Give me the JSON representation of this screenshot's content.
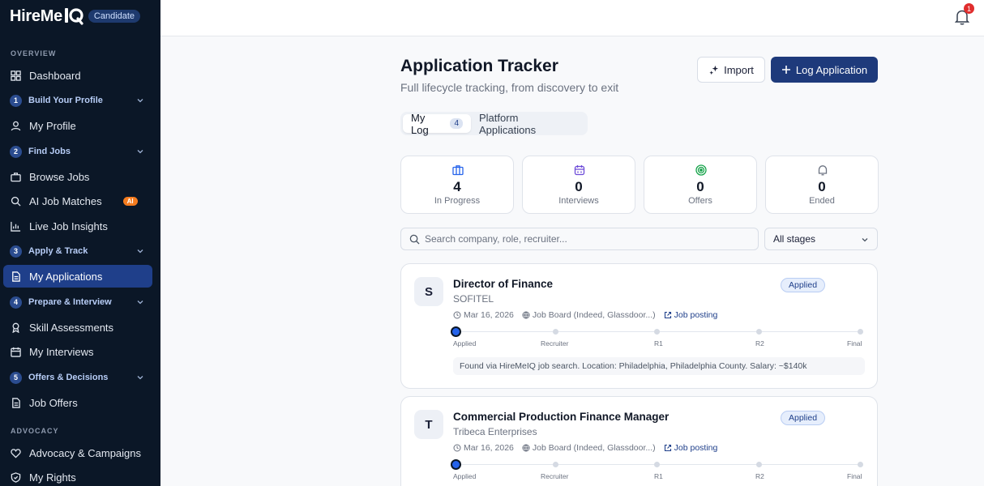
{
  "brand": {
    "name": "HireMe",
    "mark": "IQ",
    "role_badge": "Candidate"
  },
  "sidebar": {
    "sections": [
      {
        "label": "OVERVIEW"
      },
      {
        "label": "ADVOCACY"
      }
    ],
    "items": [
      {
        "label": "Dashboard",
        "icon": "grid-icon"
      },
      {
        "label": "Build Your Profile",
        "step": "1",
        "group": true
      },
      {
        "label": "My Profile",
        "icon": "user-icon"
      },
      {
        "label": "Find Jobs",
        "step": "2",
        "group": true
      },
      {
        "label": "Browse Jobs",
        "icon": "briefcase-icon"
      },
      {
        "label": "AI Job Matches",
        "icon": "search-icon",
        "badge": "AI"
      },
      {
        "label": "Live Job Insights",
        "icon": "chart-icon"
      },
      {
        "label": "Apply & Track",
        "step": "3",
        "group": true
      },
      {
        "label": "My Applications",
        "icon": "document-icon",
        "active": true
      },
      {
        "label": "Prepare & Interview",
        "step": "4",
        "group": true
      },
      {
        "label": "Skill Assessments",
        "icon": "award-icon"
      },
      {
        "label": "My Interviews",
        "icon": "calendar-icon"
      },
      {
        "label": "Offers & Decisions",
        "step": "5",
        "group": true
      },
      {
        "label": "Job Offers",
        "icon": "document-icon"
      },
      {
        "label": "Advocacy & Campaigns",
        "icon": "heart-icon"
      },
      {
        "label": "My Rights",
        "icon": "shield-icon"
      }
    ]
  },
  "topbar": {
    "notification_count": "1"
  },
  "header": {
    "title": "Application Tracker",
    "subtitle": "Full lifecycle tracking, from discovery to exit",
    "import_label": "Import",
    "log_label": "Log Application"
  },
  "tabs": [
    {
      "label": "My Log",
      "count": "4",
      "active": true
    },
    {
      "label": "Platform Applications"
    }
  ],
  "stats": [
    {
      "value": "4",
      "label": "In Progress",
      "icon": "briefcase-icon",
      "color": "#2563eb"
    },
    {
      "value": "0",
      "label": "Interviews",
      "icon": "calendar-icon",
      "color": "#6d4bd8"
    },
    {
      "value": "0",
      "label": "Offers",
      "icon": "target-icon",
      "color": "#16a34a"
    },
    {
      "value": "0",
      "label": "Ended",
      "icon": "bell-icon",
      "color": "#6b7280"
    }
  ],
  "filters": {
    "search_placeholder": "Search company, role, recruiter...",
    "stage_value": "All stages"
  },
  "stages": [
    "Applied",
    "Recruiter",
    "R1",
    "R2",
    "Final"
  ],
  "applications": [
    {
      "initial": "S",
      "role": "Director of Finance",
      "company": "SOFITEL",
      "status": "Applied",
      "date": "Mar 16, 2026",
      "source": "Job Board (Indeed, Glassdoor...)",
      "link": "Job posting",
      "note": "Found via HireMeIQ job search. Location: Philadelphia, Philadelphia County. Salary: ~$140k"
    },
    {
      "initial": "T",
      "role": "Commercial Production Finance Manager",
      "company": "Tribeca Enterprises",
      "status": "Applied",
      "date": "Mar 16, 2026",
      "source": "Job Board (Indeed, Glassdoor...)",
      "link": "Job posting"
    }
  ],
  "colors": {
    "sidebar_bg": "#0b1727",
    "accent": "#1e3a7b",
    "active_item": "#1f3f8a"
  }
}
